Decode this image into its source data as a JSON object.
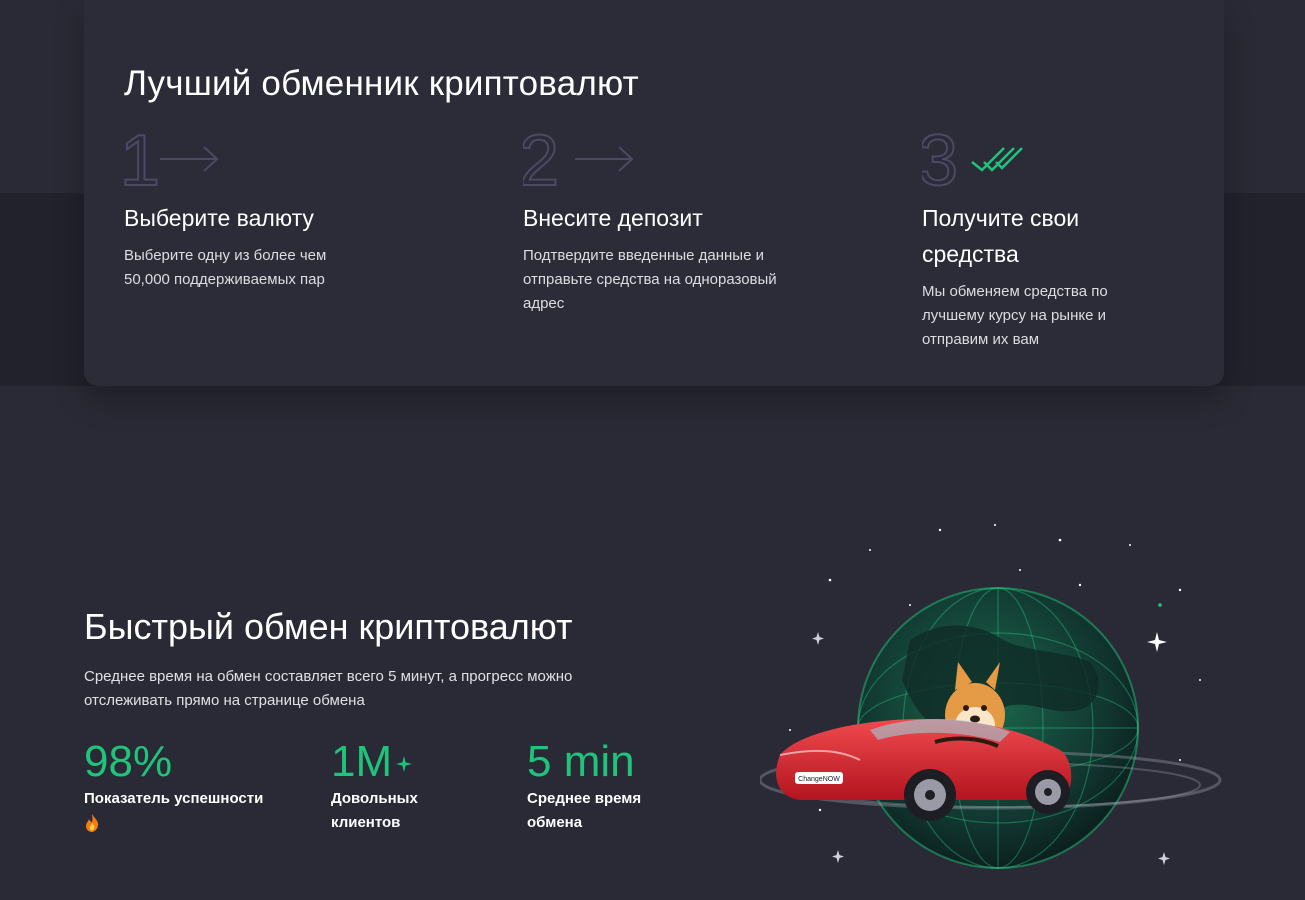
{
  "how_it_works": {
    "title": "Лучший обменник криптовалют",
    "steps": [
      {
        "number": "1",
        "icon": "arrow-right-icon",
        "title": "Выберите валюту",
        "text": "Выберите одну из более чем 50,000 поддерживаемых пар"
      },
      {
        "number": "2",
        "icon": "arrow-right-icon",
        "title": "Внесите депозит",
        "text": "Подтвердите введенные данные и отправьте средства на одноразовый адрес"
      },
      {
        "number": "3",
        "icon": "double-check-icon",
        "title": "Получите свои средства",
        "text": "Мы обменяем средства по лучшему курсу на рынке и отправим их вам"
      }
    ]
  },
  "fast_exchange": {
    "title": "Быстрый обмен криптовалют",
    "description": "Среднее время на обмен составляет всего 5 минут, а прогресс можно отслеживать прямо на странице обмена",
    "stats": [
      {
        "value": "98%",
        "label": "Показатель успешности",
        "icon": "fire-icon"
      },
      {
        "value": "1M",
        "label": "Довольных клиентов",
        "icon": "sparkle-icon"
      },
      {
        "value": "5 min",
        "label": "Среднее время обмена"
      }
    ]
  },
  "illustration": {
    "icon": "doge-car-globe-illustration",
    "car_plate": "ChangeNOW"
  },
  "colors": {
    "background": "#292a35",
    "card": "#2b2c38",
    "accent_green": "#1fc47a",
    "step_number_outline": "#4b4963"
  }
}
